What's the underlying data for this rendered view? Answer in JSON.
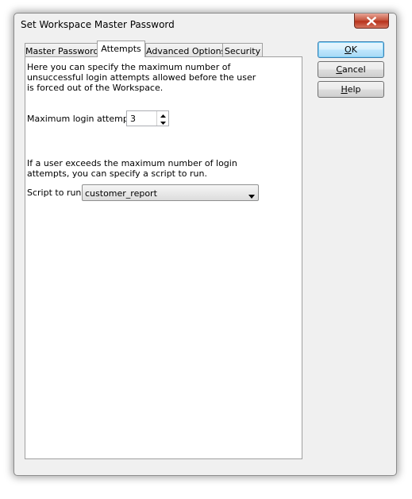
{
  "window": {
    "title": "Set Workspace Master Password",
    "close_icon": "close-icon"
  },
  "tabs": [
    {
      "label": "Master Password",
      "active": false
    },
    {
      "label": "Attempts",
      "active": true
    },
    {
      "label": "Advanced Options",
      "active": false
    },
    {
      "label": "Security",
      "active": false
    }
  ],
  "attempts": {
    "description": "Here you can specify the maximum number of unsuccessful login attempts allowed before the user is forced out of the Workspace.",
    "max_label": "Maximum login attempts:",
    "max_value": "3",
    "script_description": "If a user exceeds the maximum number of login attempts, you can specify a script to run.",
    "script_label": "Script to run:",
    "script_value": "customer_report"
  },
  "buttons": {
    "ok": {
      "mnemonic": "O",
      "rest": "K"
    },
    "cancel": {
      "mnemonic": "C",
      "rest": "ancel"
    },
    "help": {
      "mnemonic": "H",
      "rest": "elp"
    }
  }
}
